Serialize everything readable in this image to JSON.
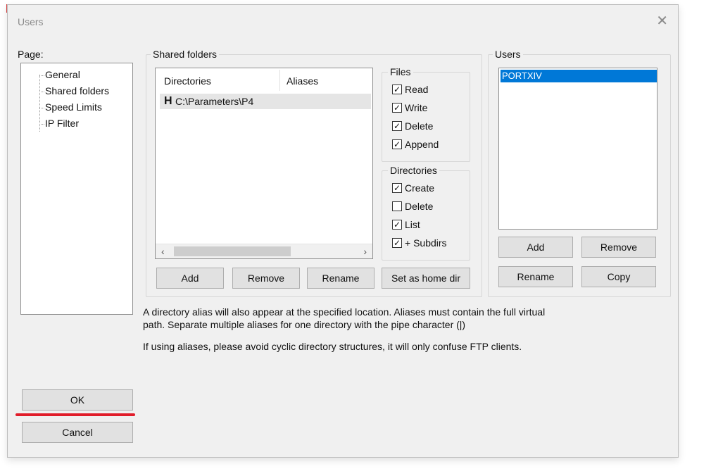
{
  "window": {
    "title": "Users"
  },
  "page_panel": {
    "label": "Page:",
    "items": [
      "General",
      "Shared folders",
      "Speed Limits",
      "IP Filter"
    ]
  },
  "shared_folders": {
    "legend": "Shared folders",
    "columns": [
      "Directories",
      "Aliases"
    ],
    "rows": [
      {
        "type_marker": "H",
        "path": "C:\\Parameters\\P4",
        "alias": ""
      }
    ],
    "buttons": {
      "add": "Add",
      "remove": "Remove",
      "rename": "Rename",
      "set_home": "Set as home dir"
    }
  },
  "files_group": {
    "legend": "Files",
    "options": [
      {
        "label": "Read",
        "checked": true
      },
      {
        "label": "Write",
        "checked": true
      },
      {
        "label": "Delete",
        "checked": true
      },
      {
        "label": "Append",
        "checked": true
      }
    ]
  },
  "directories_group": {
    "legend": "Directories",
    "options": [
      {
        "label": "Create",
        "checked": true
      },
      {
        "label": "Delete",
        "checked": false
      },
      {
        "label": "List",
        "checked": true
      },
      {
        "label": "+ Subdirs",
        "checked": true
      }
    ]
  },
  "users_group": {
    "legend": "Users",
    "list": [
      "PORTXIV"
    ],
    "buttons": {
      "add": "Add",
      "remove": "Remove",
      "rename": "Rename",
      "copy": "Copy"
    }
  },
  "info_text": {
    "line1": "A directory alias will also appear at the specified location. Aliases must contain the full virtual",
    "line2": "path. Separate multiple aliases for one directory with the pipe character (|)",
    "line3": "If using aliases, please avoid cyclic directory structures, it will only confuse FTP clients."
  },
  "footer_buttons": {
    "ok": "OK",
    "cancel": "Cancel"
  },
  "colors": {
    "selection": "#0078d7",
    "underline": "#e11d2a"
  }
}
